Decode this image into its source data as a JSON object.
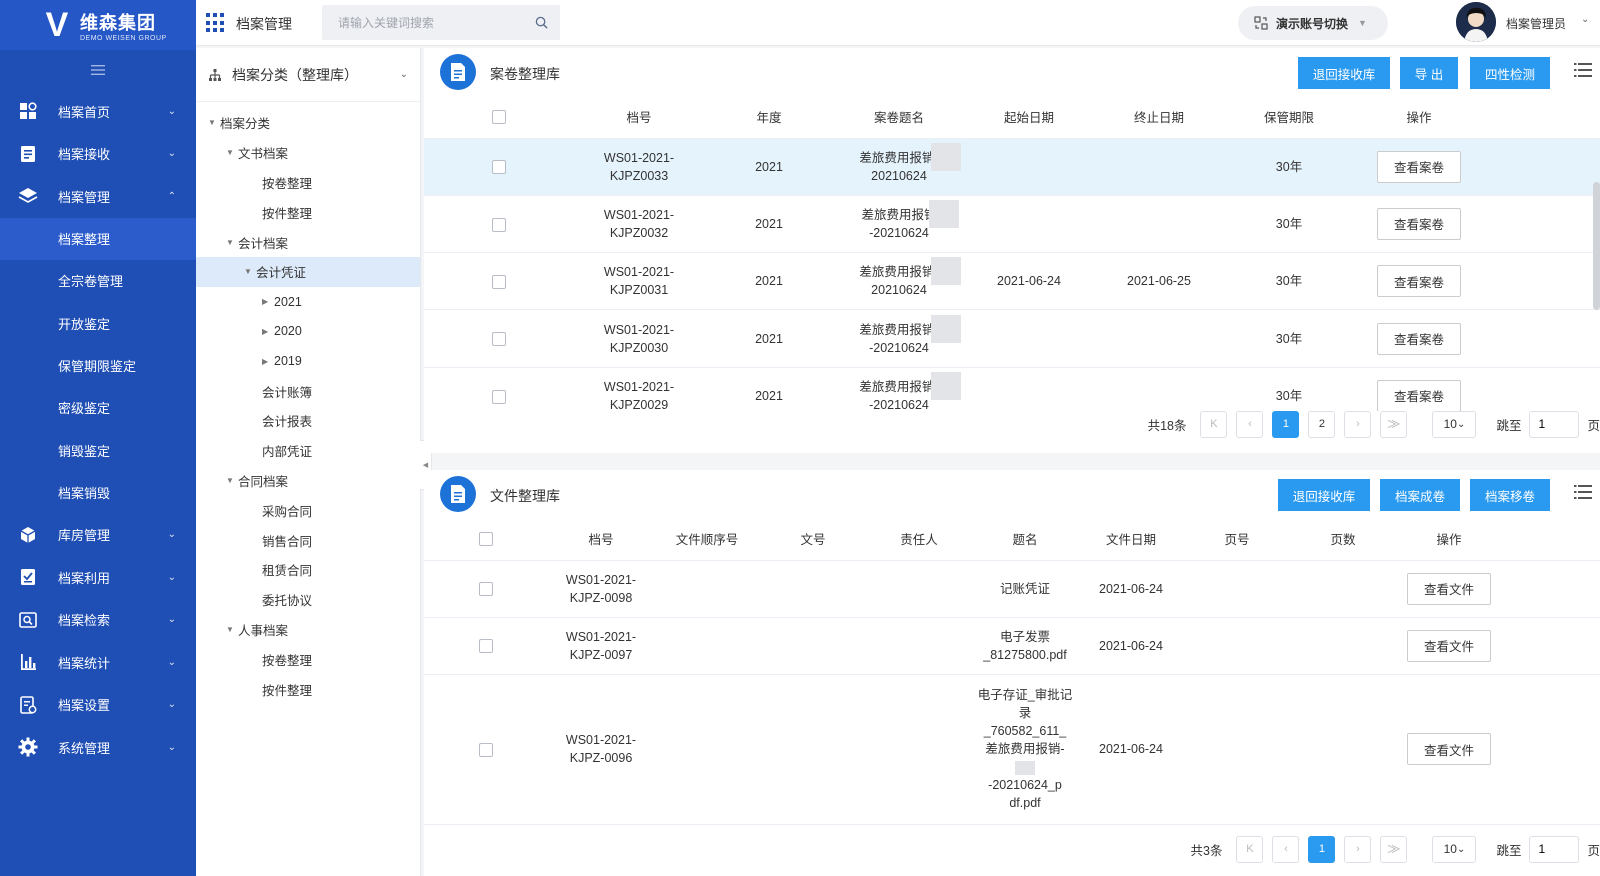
{
  "brand": {
    "name_cn": "维森集团",
    "name_en": "DEMO WEISEN GROUP",
    "logo_letter": "V"
  },
  "nav": [
    {
      "label": "档案首页",
      "icon": "dashboard-icon",
      "expanded": false
    },
    {
      "label": "档案接收",
      "icon": "receive-icon",
      "expanded": false
    },
    {
      "label": "档案管理",
      "icon": "layers-icon",
      "expanded": true
    }
  ],
  "nav_sub": [
    "档案整理",
    "全宗卷管理",
    "开放鉴定",
    "保管期限鉴定",
    "密级鉴定",
    "销毁鉴定",
    "档案销毁"
  ],
  "nav_sub_active": 0,
  "nav_after": [
    {
      "label": "库房管理",
      "icon": "cube-icon"
    },
    {
      "label": "档案利用",
      "icon": "check-board-icon"
    },
    {
      "label": "档案检索",
      "icon": "search-doc-icon"
    },
    {
      "label": "档案统计",
      "icon": "bar-chart-icon"
    },
    {
      "label": "档案设置",
      "icon": "settings-doc-icon"
    },
    {
      "label": "系统管理",
      "icon": "gear-icon"
    }
  ],
  "header": {
    "module_title": "档案管理",
    "search_placeholder": "请输入关键词搜索",
    "account_switch": "演示账号切换",
    "user_name": "档案管理员"
  },
  "tree": {
    "title": "档案分类（整理库）",
    "nodes": [
      {
        "label": "档案分类",
        "level": 0,
        "toggle": "open"
      },
      {
        "label": "文书档案",
        "level": 1,
        "toggle": "open"
      },
      {
        "label": "按卷整理",
        "level": 2,
        "toggle": ""
      },
      {
        "label": "按件整理",
        "level": 2,
        "toggle": ""
      },
      {
        "label": "会计档案",
        "level": 1,
        "toggle": "open"
      },
      {
        "label": "会计凭证",
        "level": 2,
        "toggle": "open",
        "selected": true
      },
      {
        "label": "2021",
        "level": 3,
        "toggle": "closed"
      },
      {
        "label": "2020",
        "level": 3,
        "toggle": "closed"
      },
      {
        "label": "2019",
        "level": 3,
        "toggle": "closed"
      },
      {
        "label": "会计账簿",
        "level": 2,
        "toggle": ""
      },
      {
        "label": "会计报表",
        "level": 2,
        "toggle": ""
      },
      {
        "label": "内部凭证",
        "level": 2,
        "toggle": ""
      },
      {
        "label": "合同档案",
        "level": 1,
        "toggle": "open"
      },
      {
        "label": "采购合同",
        "level": 2,
        "toggle": ""
      },
      {
        "label": "销售合同",
        "level": 2,
        "toggle": ""
      },
      {
        "label": "租赁合同",
        "level": 2,
        "toggle": ""
      },
      {
        "label": "委托协议",
        "level": 2,
        "toggle": ""
      },
      {
        "label": "人事档案",
        "level": 1,
        "toggle": "open"
      },
      {
        "label": "按卷整理",
        "level": 2,
        "toggle": ""
      },
      {
        "label": "按件整理",
        "level": 2,
        "toggle": ""
      }
    ]
  },
  "volumes": {
    "title": "案卷整理库",
    "buttons": [
      "退回接收库",
      "导 出",
      "四性检测"
    ],
    "columns": [
      "档号",
      "年度",
      "案卷题名",
      "起始日期",
      "终止日期",
      "保管期限",
      "操作"
    ],
    "rows": [
      {
        "code": [
          "WS01-2021-",
          "KJPZ0033"
        ],
        "year": "2021",
        "title": [
          "差旅费用报销-",
          "20210624"
        ],
        "start": "",
        "end": "",
        "term": "30年",
        "action": "查看案卷",
        "highlight": true
      },
      {
        "code": [
          "WS01-2021-",
          "KJPZ0032"
        ],
        "year": "2021",
        "title": [
          "差旅费用报销",
          "-20210624"
        ],
        "start": "",
        "end": "",
        "term": "30年",
        "action": "查看案卷"
      },
      {
        "code": [
          "WS01-2021-",
          "KJPZ0031"
        ],
        "year": "2021",
        "title": [
          "差旅费用报销-",
          "20210624"
        ],
        "start": "2021-06-24",
        "end": "2021-06-25",
        "term": "30年",
        "action": "查看案卷"
      },
      {
        "code": [
          "WS01-2021-",
          "KJPZ0030"
        ],
        "year": "2021",
        "title": [
          "差旅费用报销-",
          "-20210624"
        ],
        "start": "",
        "end": "",
        "term": "30年",
        "action": "查看案卷"
      },
      {
        "code": [
          "WS01-2021-",
          "KJPZ0029"
        ],
        "year": "2021",
        "title": [
          "差旅费用报销-",
          "-20210624"
        ],
        "start": "",
        "end": "",
        "term": "30年",
        "action": "查看案卷"
      }
    ],
    "pager": {
      "total": "共18条",
      "pages": [
        "1",
        "2"
      ],
      "current": "1",
      "size": "10",
      "jump_label": "跳至",
      "jump_value": "1",
      "page_unit": "页"
    }
  },
  "files": {
    "title": "文件整理库",
    "buttons": [
      "退回接收库",
      "档案成卷",
      "档案移卷"
    ],
    "columns": [
      "档号",
      "文件顺序号",
      "文号",
      "责任人",
      "题名",
      "文件日期",
      "页号",
      "页数",
      "操作"
    ],
    "rows": [
      {
        "code": [
          "WS01-2021-",
          "KJPZ-0098"
        ],
        "seq": "",
        "num": "",
        "person": "",
        "title": [
          "记账凭证"
        ],
        "date": "2021-06-24",
        "page_no": "",
        "pages": "",
        "action": "查看文件"
      },
      {
        "code": [
          "WS01-2021-",
          "KJPZ-0097"
        ],
        "seq": "",
        "num": "",
        "person": "",
        "title": [
          "电子发票",
          "_81275800.pdf"
        ],
        "date": "2021-06-24",
        "page_no": "",
        "pages": "",
        "action": "查看文件"
      },
      {
        "code": [
          "WS01-2021-",
          "KJPZ-0096"
        ],
        "seq": "",
        "num": "",
        "person": "",
        "title": [
          "电子存证_审批记",
          "录",
          "_760582_611_",
          "差旅费用报销-",
          "",
          "-20210624_p",
          "df.pdf"
        ],
        "date": "2021-06-24",
        "page_no": "",
        "pages": "",
        "action": "查看文件"
      }
    ],
    "pager": {
      "total": "共3条",
      "pages": [
        "1"
      ],
      "current": "1",
      "size": "10",
      "jump_label": "跳至",
      "jump_value": "1",
      "page_unit": "页"
    }
  },
  "colors": {
    "sidebar": "#1f4eb4",
    "primary_button": "#2a9af0",
    "row_highlight": "#e5f3fc",
    "tree_selected": "#dceaf9"
  }
}
